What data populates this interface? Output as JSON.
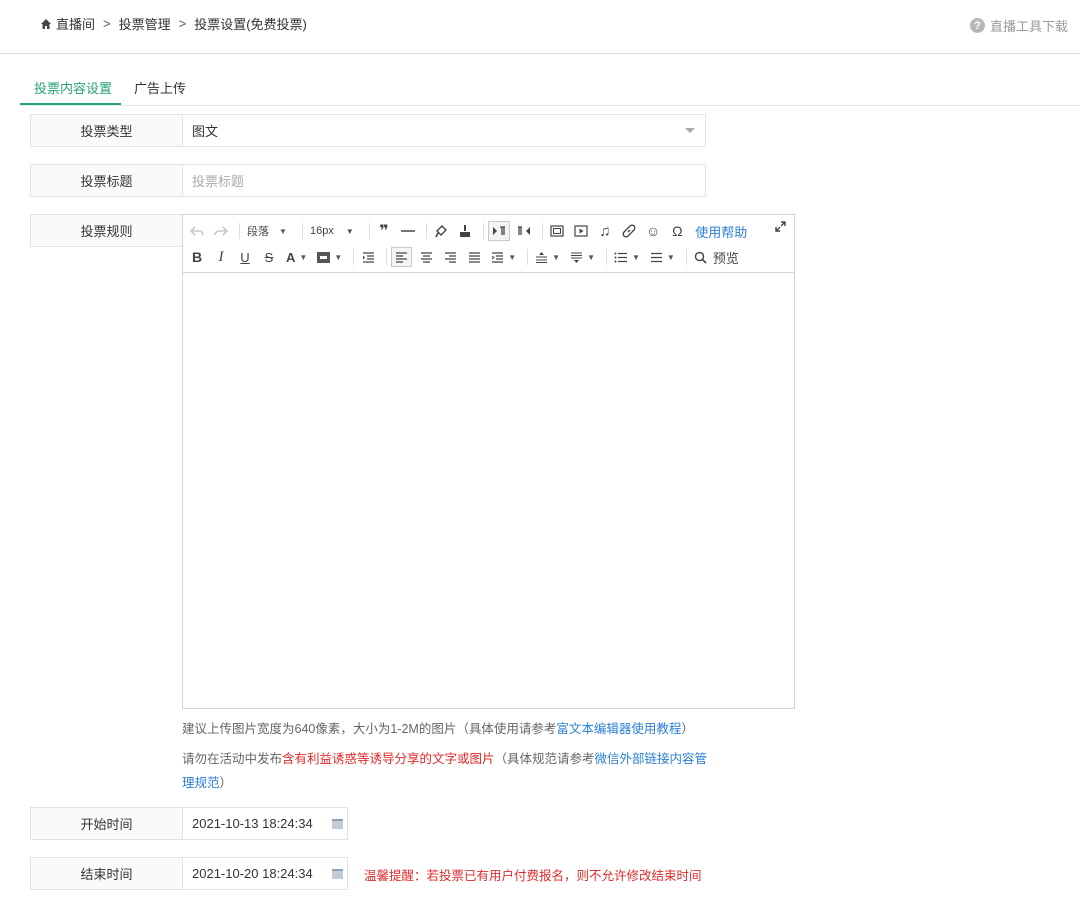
{
  "breadcrumb": {
    "items": [
      "直播间",
      "投票管理",
      "投票设置(免费投票)"
    ],
    "separator": ">"
  },
  "topbar": {
    "download_label": "直播工具下载",
    "help_glyph": "?"
  },
  "tabs": [
    {
      "label": "投票内容设置",
      "active": true
    },
    {
      "label": "广告上传",
      "active": false
    }
  ],
  "form": {
    "type": {
      "label": "投票类型",
      "value": "图文"
    },
    "title": {
      "label": "投票标题",
      "placeholder": "投票标题"
    },
    "rules": {
      "label": "投票规则"
    },
    "start": {
      "label": "开始时间",
      "value": "2021-10-13 18:24:34"
    },
    "end": {
      "label": "结束时间",
      "value": "2021-10-20 18:24:34"
    }
  },
  "editor": {
    "paragraph_label": "段落",
    "fontsize_label": "16px",
    "help_label": "使用帮助",
    "preview_label": "预览",
    "icons_row1": [
      "undo-icon",
      "redo-icon",
      "blockquote-icon",
      "horizontal-rule-icon",
      "format-brush-icon",
      "clear-format-icon",
      "ltr-icon",
      "rtl-icon",
      "image-icon",
      "video-icon",
      "music-icon",
      "link-icon",
      "emoji-icon",
      "omega-icon",
      "expand-icon"
    ],
    "icons_row2": [
      "bold-icon",
      "italic-icon",
      "underline-icon",
      "strikethrough-icon",
      "font-color-icon",
      "background-color-icon",
      "indent-icon",
      "align-left-icon",
      "align-center-icon",
      "align-right-icon",
      "justify-icon",
      "line-height-icon",
      "paragraph-spacing-top-icon",
      "paragraph-spacing-bottom-icon",
      "ordered-list-icon",
      "unordered-list-icon",
      "preview-icon"
    ]
  },
  "notes": {
    "upload_prefix": "建议上传图片宽度为640像素，大小为1-2M的图片（具体使用请参考",
    "upload_link": "富文本编辑器使用教程",
    "upload_suffix": "）",
    "policy_prefix": "请勿在活动中发布",
    "policy_red": "含有利益诱惑等诱导分享的文字或图片",
    "policy_mid": "（具体规范请参考",
    "policy_link_1": "微信外部链接内容管",
    "policy_link_2": "理规范",
    "policy_suffix": "）",
    "end_warning": "温馨提醒：若投票已有用户付费报名，则不允许修改结束时间"
  },
  "colors": {
    "accent": "#26a17a",
    "link": "#2b7fd8",
    "warning": "#e02b2b"
  }
}
